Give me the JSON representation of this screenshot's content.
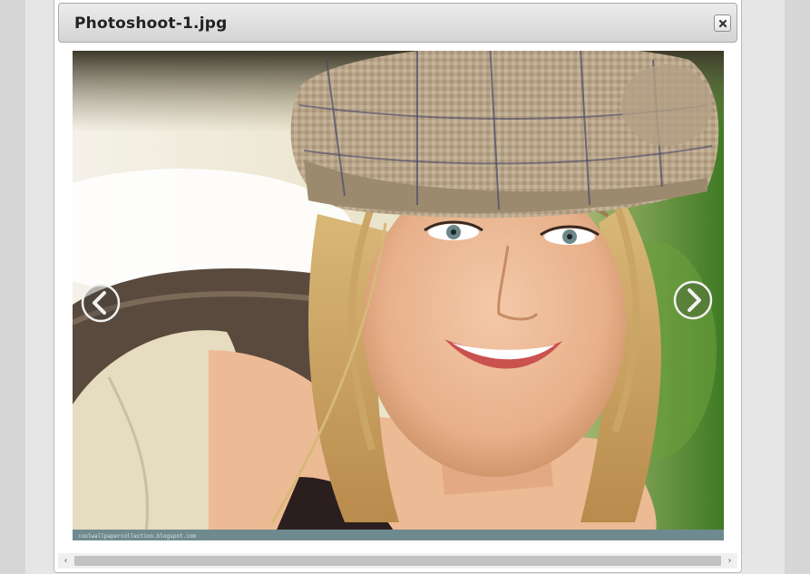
{
  "dialog": {
    "title": "Photoshoot-1.jpg",
    "close_icon": "close-icon"
  },
  "image": {
    "watermark": "coolwallpapercollection.blogspot.com",
    "prev_icon": "chevron-left-circle-icon",
    "next_icon": "chevron-right-circle-icon"
  },
  "scrollbar": {
    "left_icon": "scroll-left-arrow-icon",
    "right_icon": "scroll-right-arrow-icon",
    "left_glyph": "‹",
    "right_glyph": "›"
  },
  "colors": {
    "titlebar_top": "#ececec",
    "titlebar_bottom": "#d4d4d4",
    "page_background": "#e6e6e6",
    "watermark_strip": "#6f8a8f"
  }
}
